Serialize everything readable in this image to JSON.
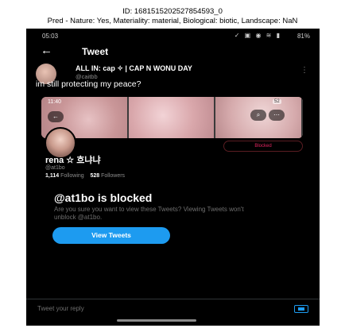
{
  "caption": {
    "id_line": "ID: 1681515202527854593_0",
    "pred_line": "Pred - Nature: Yes, Materiality: material, Biological: biotic, Landscape: NaN"
  },
  "status_bar": {
    "time": "05:03",
    "icons": "✓ ▣ ◉ ≋ ▮",
    "battery": "81%"
  },
  "header": {
    "back_glyph": "←",
    "title": "Tweet"
  },
  "tweet": {
    "author_name": "ALL IN: cap ✧ | CAP N WONU DAY",
    "author_handle": "@caitbb",
    "text": "im still protecting my peace?"
  },
  "embedded_profile": {
    "banner_time": "11:40",
    "banner_battery": "52",
    "blocked_label": "Blocked",
    "name": "rena ☆ 흐냐냐",
    "handle": "@at1bo",
    "following_count": "1,114",
    "following_label": "Following",
    "followers_count": "528",
    "followers_label": "Followers"
  },
  "blocked_notice": {
    "title": "@at1bo is blocked",
    "description": "Are you sure you want to view these Tweets? Viewing Tweets won't unblock @at1bo.",
    "button": "View Tweets"
  },
  "reply_bar": {
    "placeholder": "Tweet your reply"
  },
  "colors": {
    "accent": "#1d9bf0",
    "blocked_red": "#e0245e",
    "background": "#000000"
  }
}
